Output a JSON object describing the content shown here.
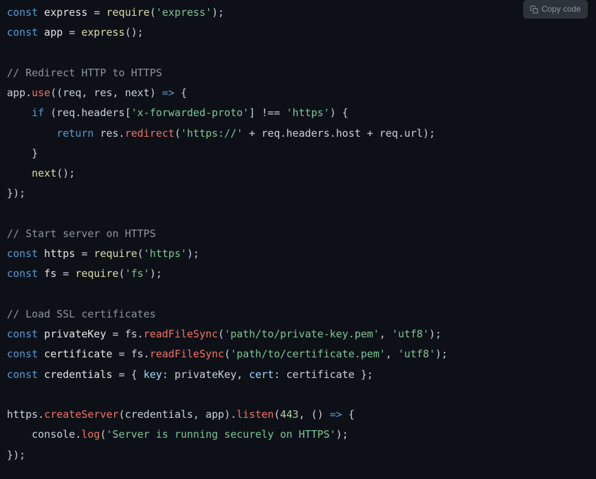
{
  "copy_button": "Copy code",
  "code": {
    "l1": {
      "kw": "const",
      "id": " express ",
      "op": "= ",
      "fn": "require",
      "p1": "(",
      "s": "'express'",
      "p2": ");"
    },
    "l2": {
      "kw": "const",
      "id": " app ",
      "op": "= ",
      "fn": "express",
      "p": "();"
    },
    "l3": "",
    "l4": {
      "cmt": "// Redirect HTTP to HTTPS"
    },
    "l5": {
      "a": "app.",
      "m": "use",
      "b": "((req, res, next) ",
      "arrow": "=>",
      "c": " {"
    },
    "l6": {
      "pad": "    ",
      "kw": "if",
      "a": " (req.headers[",
      "s": "'x-forwarded-proto'",
      "b": "] !== ",
      "s2": "'https'",
      "c": ") {"
    },
    "l7": {
      "pad": "        ",
      "kw": "return",
      "a": " res.",
      "m": "redirect",
      "b": "(",
      "s": "'https://'",
      "c": " + req.headers.host + req.url);"
    },
    "l8": {
      "pad": "    ",
      "a": "}"
    },
    "l9": {
      "pad": "    ",
      "fn": "next",
      "a": "();"
    },
    "l10": {
      "a": "});"
    },
    "l11": "",
    "l12": {
      "cmt": "// Start server on HTTPS"
    },
    "l13": {
      "kw": "const",
      "id": " https ",
      "op": "= ",
      "fn": "require",
      "p1": "(",
      "s": "'https'",
      "p2": ");"
    },
    "l14": {
      "kw": "const",
      "id": " fs ",
      "op": "= ",
      "fn": "require",
      "p1": "(",
      "s": "'fs'",
      "p2": ");"
    },
    "l15": "",
    "l16": {
      "cmt": "// Load SSL certificates"
    },
    "l17": {
      "kw": "const",
      "id": " privateKey ",
      "op": "= fs.",
      "m": "readFileSync",
      "p1": "(",
      "s": "'path/to/private-key.pem'",
      "c": ", ",
      "s2": "'utf8'",
      "p2": ");"
    },
    "l18": {
      "kw": "const",
      "id": " certificate ",
      "op": "= fs.",
      "m": "readFileSync",
      "p1": "(",
      "s": "'path/to/certificate.pem'",
      "c": ", ",
      "s2": "'utf8'",
      "p2": ");"
    },
    "l19": {
      "kw": "const",
      "id": " credentials ",
      "op": "= { ",
      "k1": "key",
      "a": ": privateKey, ",
      "k2": "cert",
      "b": ": certificate };"
    },
    "l20": "",
    "l21": {
      "a": "https.",
      "m": "createServer",
      "b": "(credentials, app).",
      "m2": "listen",
      "c": "(",
      "n": "443",
      "d": ", () ",
      "arrow": "=>",
      "e": " {"
    },
    "l22": {
      "pad": "    ",
      "a": "console.",
      "m": "log",
      "b": "(",
      "s": "'Server is running securely on HTTPS'",
      "c": ");"
    },
    "l23": {
      "a": "});"
    }
  }
}
